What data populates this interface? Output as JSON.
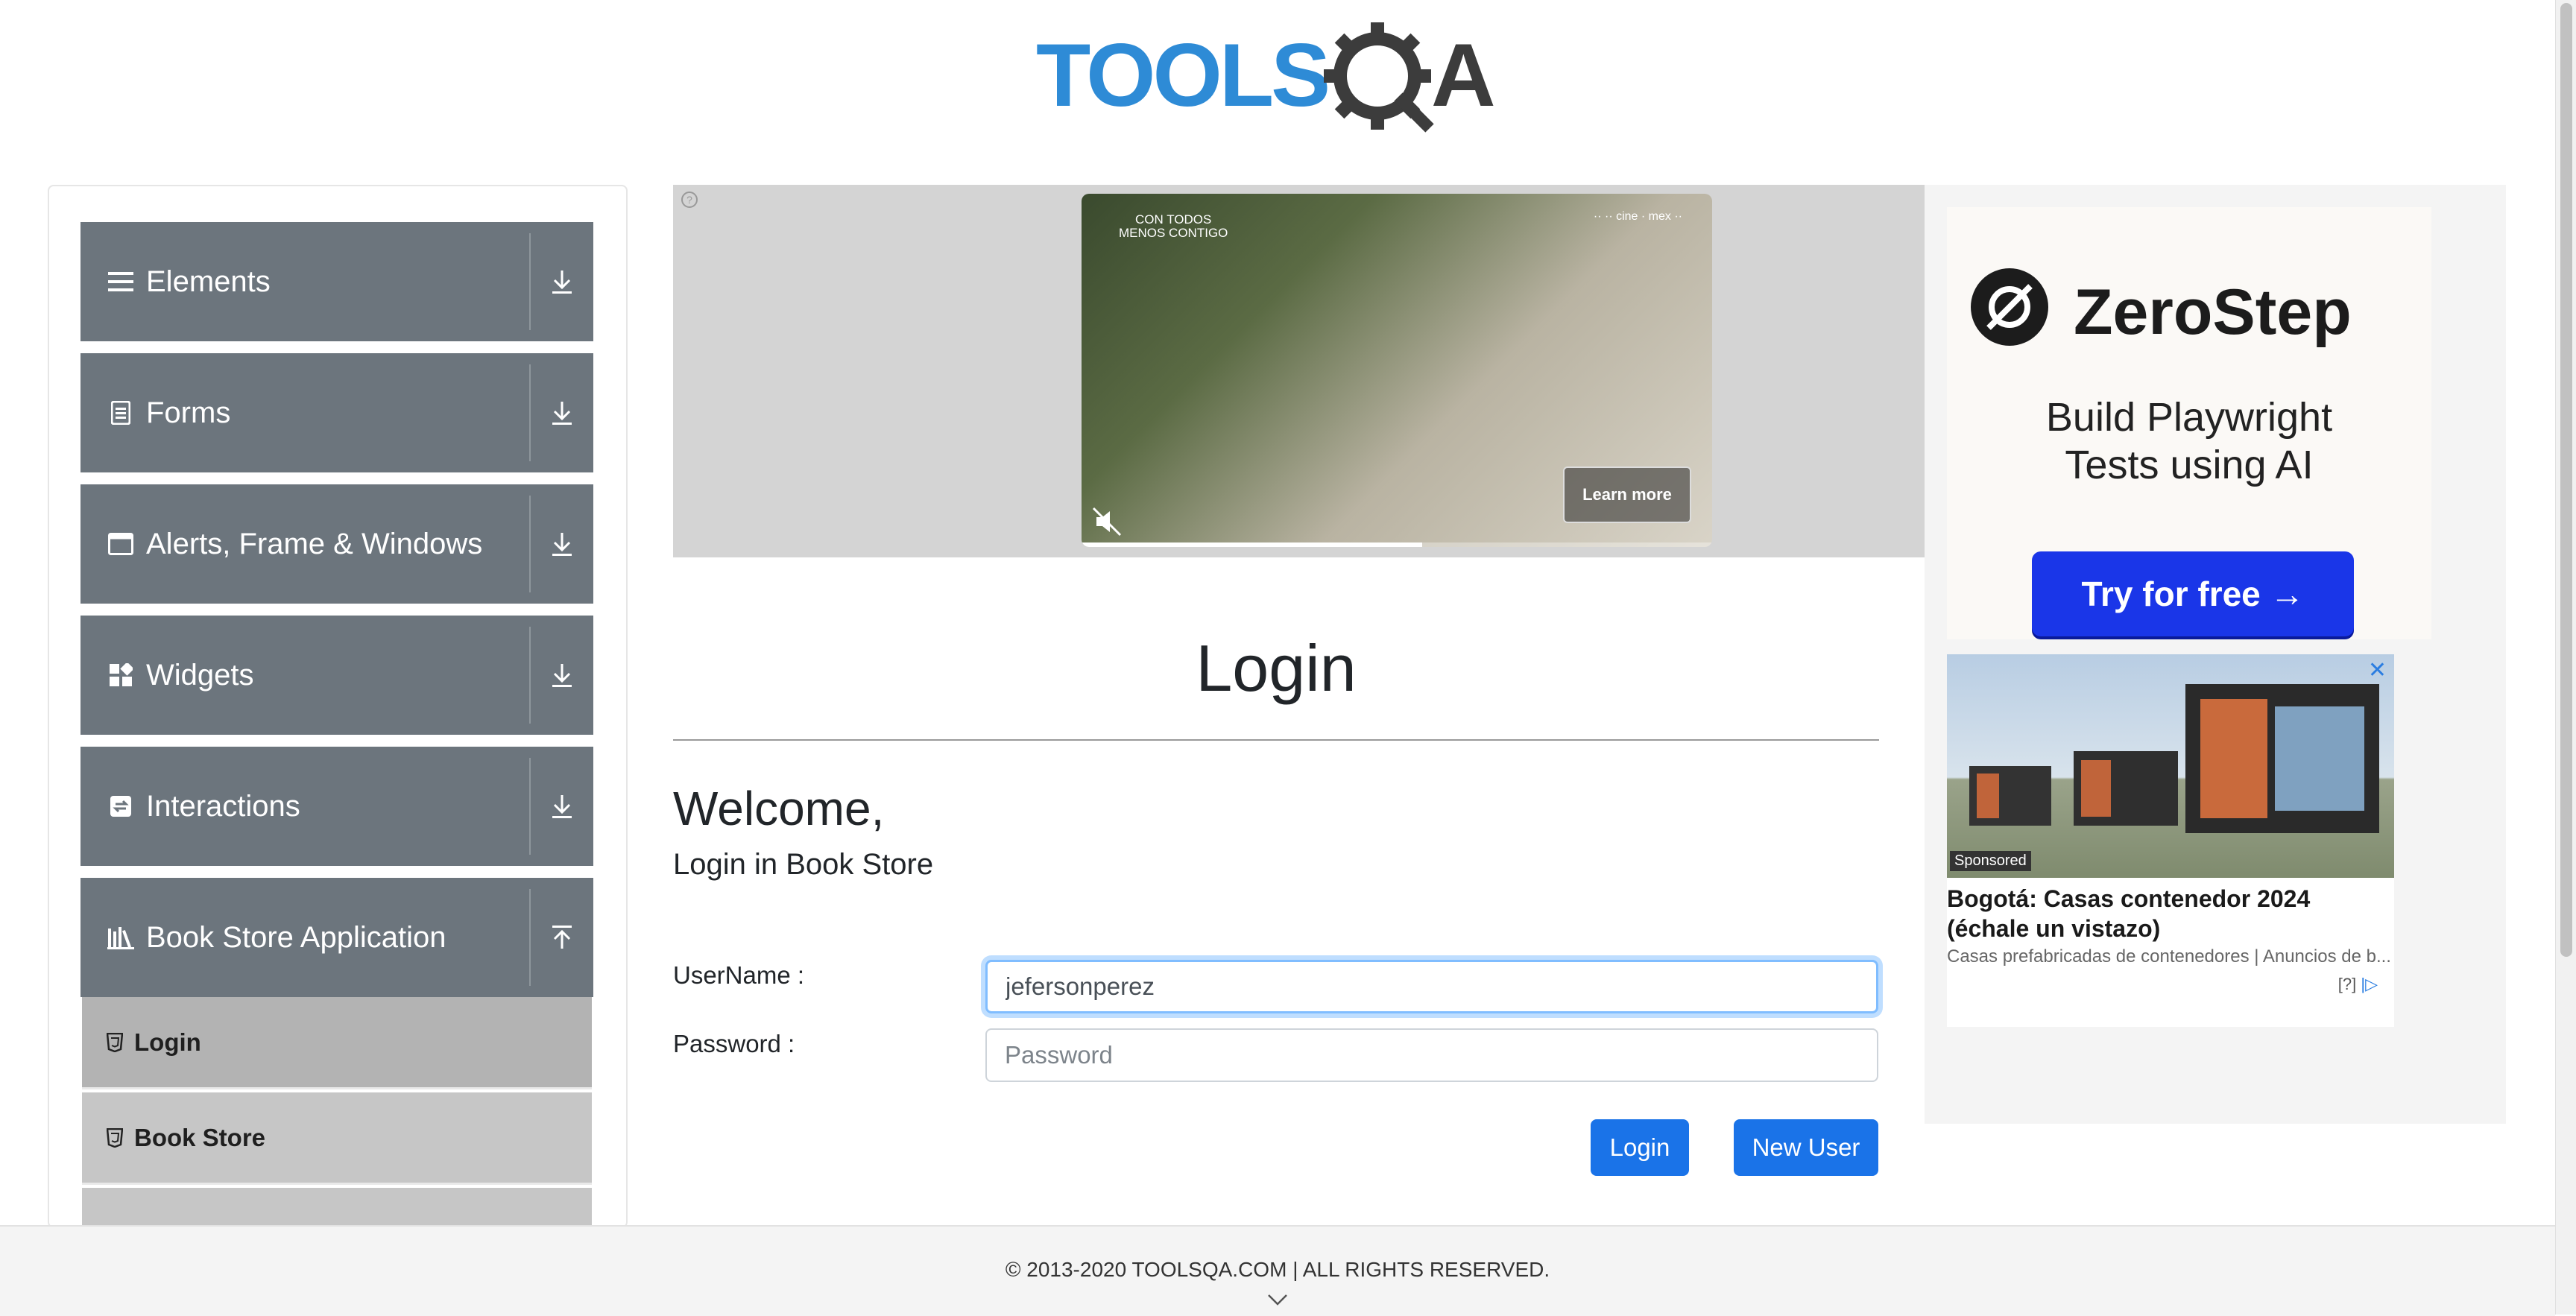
{
  "header": {
    "logo_text": "TOOLSQA"
  },
  "sidebar": {
    "groups": [
      {
        "label": "Elements",
        "icon": "hamburger-icon",
        "expanded": false
      },
      {
        "label": "Forms",
        "icon": "document-icon",
        "expanded": false
      },
      {
        "label": "Alerts, Frame & Windows",
        "icon": "window-icon",
        "expanded": false
      },
      {
        "label": "Widgets",
        "icon": "widgets-icon",
        "expanded": false
      },
      {
        "label": "Interactions",
        "icon": "interactions-icon",
        "expanded": false
      },
      {
        "label": "Book Store Application",
        "icon": "books-icon",
        "expanded": true
      }
    ],
    "subitems": [
      {
        "label": "Login",
        "icon": "html5-icon",
        "active": true
      },
      {
        "label": "Book Store",
        "icon": "html5-icon",
        "active": false
      }
    ]
  },
  "video_ad": {
    "caption_left": "CON TODOS\nMENOS CONTIGO",
    "caption_right": "·· ·· cine · mex ··",
    "learn_more": "Learn more",
    "progress": 0.54
  },
  "main": {
    "page_title": "Login",
    "welcome": "Welcome,",
    "subheading": "Login in Book Store",
    "username_label": "UserName :",
    "username_value": "jefersonperez",
    "password_label": "Password :",
    "password_placeholder": "Password",
    "login_button": "Login",
    "new_user_button": "New User"
  },
  "side_ad": {
    "brand": "ZeroStep",
    "tagline": "Build Playwright Tests using AI",
    "cta": "Try for free →",
    "sponsored_badge": "Sponsored",
    "sponsored_title": "Bogotá: Casas contenedor 2024 (échale un vistazo)",
    "sponsored_sub": "Casas prefabricadas de contenedores | Anuncios de b...",
    "adchoices": "[?]"
  },
  "footer": {
    "copyright": "© 2013-2020 TOOLSQA.COM | ALL RIGHTS RESERVED."
  },
  "colors": {
    "accent": "#1a73e8",
    "sidebar_group": "#6c757d",
    "logo_blue": "#2e8bd6",
    "logo_dark": "#3c3c3c"
  }
}
